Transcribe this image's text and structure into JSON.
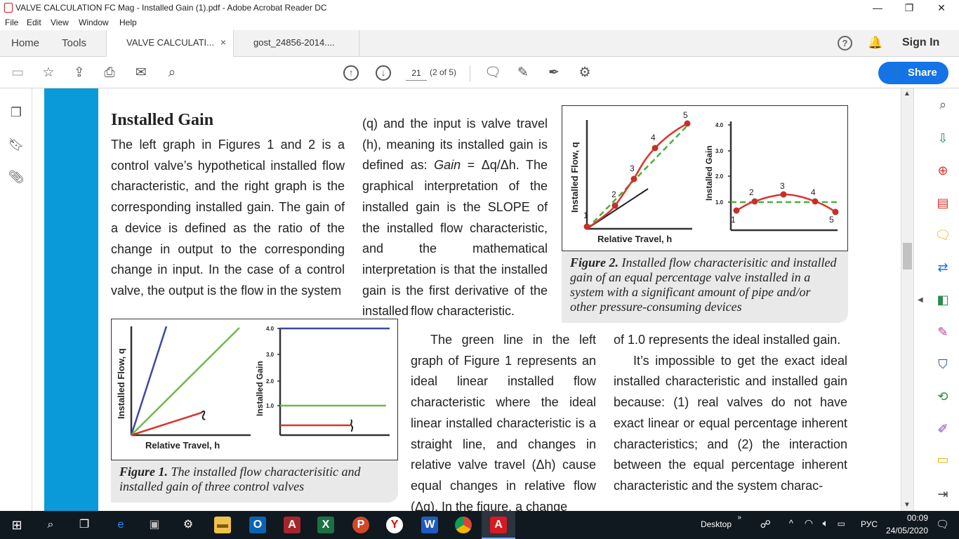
{
  "window": {
    "title": "VALVE CALCULATION FC Mag - Installed Gain (1).pdf - Adobe Acrobat Reader DC",
    "minimize": "—",
    "restore": "❐",
    "close": "✕"
  },
  "menu": [
    "File",
    "Edit",
    "View",
    "Window",
    "Help"
  ],
  "nav_tabs": {
    "home": "Home",
    "tools": "Tools"
  },
  "doc_tabs": [
    {
      "label": "VALVE CALCULATI...",
      "close": "×"
    },
    {
      "label": "gost_24856-2014...."
    }
  ],
  "header_right": {
    "sign_in": "Sign In"
  },
  "toolbar": {
    "page_current": "21",
    "page_count": "(2 of 5)",
    "share_label": "Share"
  },
  "page": {
    "heading": "Installed Gain",
    "col1": "The left graph in Figures 1 and 2 is a control valve’s hypothetical installed flow characteristic, and the right graph is the corresponding installed gain. The gain of a device is defined as the ratio of the change in output to the corresponding change in input. In the case of a control valve, the output is the flow in the system",
    "col2_a": "(q) and the input is valve travel (h), meaning its installed gain is defined as: ",
    "col2_gain": "Gain",
    "col2_b": " = Δq/Δh. The graphical interpretation of the installed gain is the SLOPE of the installed flow characteristic, and the mathematical interpretation is that the installed gain is the first derivative of the installed",
    "col2_end": "flow characteristic.",
    "col3": "The green line in the left graph of Figure 1 represents an ideal linear installed flow characteristic where the ideal linear installed characteristic is a straight line, and changes in relative valve travel (Δh) cause equal changes in relative flow (Δq). In the figure, a change",
    "col4_a": "of 1.0 represents the ideal installed gain.",
    "col4_b": "It’s impossible to get the exact ideal installed characteristic and installed gain because: (1) real valves do not have exact linear or equal percentage inherent characteristics; and (2) the interaction between the equal percentage inherent characteristic and the system charac-",
    "fig1": {
      "caption_label": "Figure 1.",
      "caption_text": " The installed flow characterisitic and installed gain of three control valves",
      "left_ylabel": "Installed Flow, q",
      "left_xlabel": "Relative Travel, h",
      "right_ylabel": "Installed Gain",
      "right_ticks": [
        "4.0",
        "3.0",
        "2.0",
        "1.0"
      ]
    },
    "fig2": {
      "caption_label": "Figure 2.",
      "caption_text": " Installed flow characterisitic and installed gain of an equal percentage valve installed in a system with a significant amount of pipe and/or other pressure-consuming devices",
      "left_ylabel": "Installed Flow, q",
      "left_xlabel": "Relative Travel, h",
      "right_ylabel": "Installed Gain",
      "right_ticks": [
        "4.0",
        "3.0",
        "2.0",
        "1.0"
      ],
      "point_labels": [
        "1",
        "2",
        "3",
        "4",
        "5"
      ]
    }
  },
  "taskbar": {
    "desktop": "Desktop",
    "lang": "РУС",
    "time": "00:09",
    "date": "24/05/2020"
  },
  "colors": {
    "accent_blue": "#0a9ad9",
    "share_blue": "#1473e6",
    "taskbar": "#101820"
  }
}
